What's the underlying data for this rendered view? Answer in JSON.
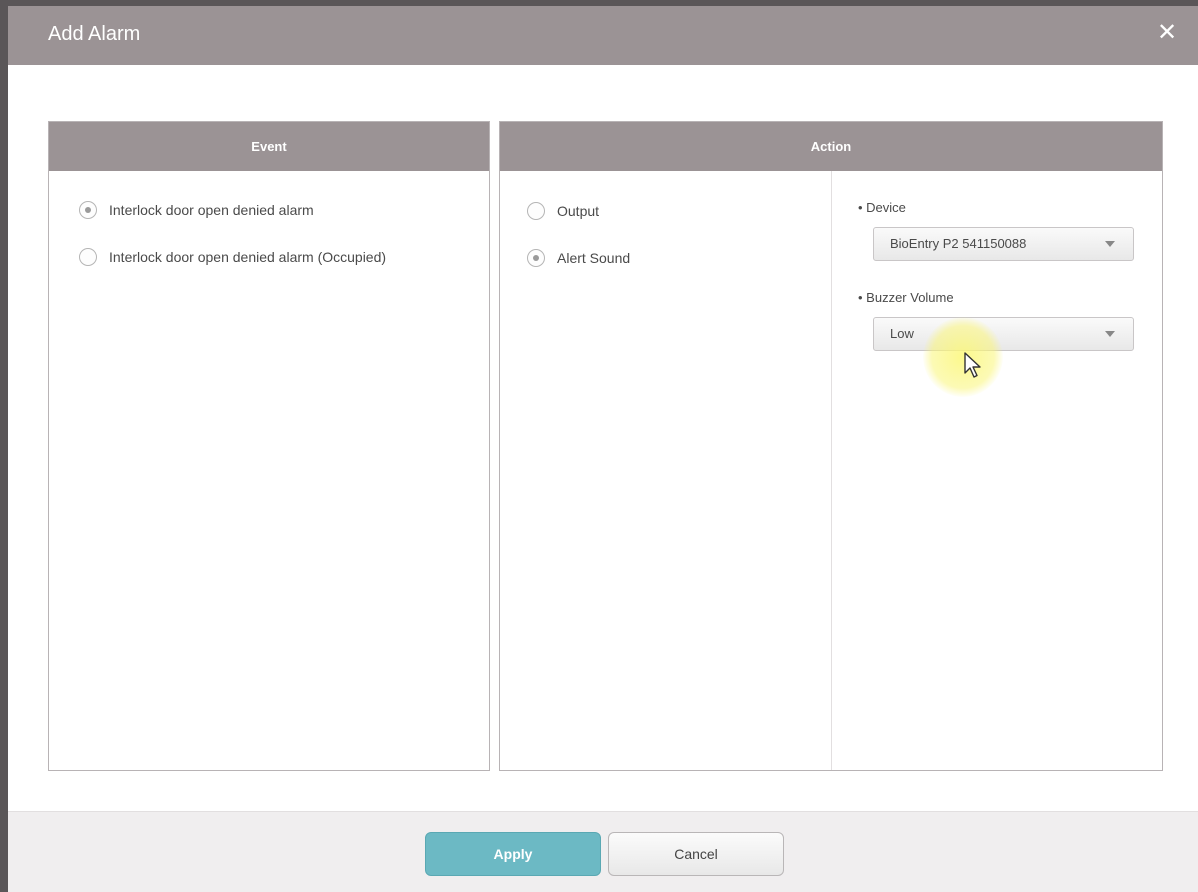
{
  "dialog": {
    "title": "Add Alarm",
    "close_icon": "close-icon"
  },
  "event_panel": {
    "header": "Event",
    "options": [
      {
        "label": "Interlock door open denied alarm",
        "checked": true
      },
      {
        "label": "Interlock door open denied alarm (Occupied)",
        "checked": false
      }
    ]
  },
  "action_panel": {
    "header": "Action",
    "options": [
      {
        "label": "Output",
        "checked": false
      },
      {
        "label": "Alert Sound",
        "checked": true
      }
    ],
    "device": {
      "label": "• Device",
      "value": "BioEntry P2 541150088"
    },
    "buzzer_volume": {
      "label": "• Buzzer Volume",
      "value": "Low"
    }
  },
  "footer": {
    "apply_label": "Apply",
    "cancel_label": "Cancel"
  },
  "colors": {
    "header_gray": "#9b9395",
    "apply_teal": "#6cb9c4"
  }
}
